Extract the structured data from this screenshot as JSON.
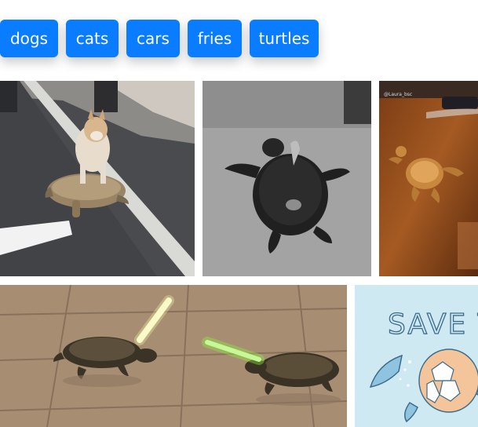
{
  "tags": [
    {
      "label": "dogs"
    },
    {
      "label": "cats"
    },
    {
      "label": "cars"
    },
    {
      "label": "fries"
    },
    {
      "label": "turtles"
    }
  ],
  "colors": {
    "tag_bg": "#0a7cff",
    "tag_text": "#ffffff",
    "page_bg": "#ffffff"
  },
  "gifs": [
    {
      "subject": "shiba dog riding tortoise on street",
      "icon": "dog-on-tortoise"
    },
    {
      "subject": "black turtle on grey floor",
      "icon": "turtle"
    },
    {
      "subject": "turtle on wooden table",
      "icon": "turtle",
      "caption": "@Laura_bsc"
    },
    {
      "subject": "two turtles with lightsabers",
      "icon": "turtles-lightsabers"
    },
    {
      "subject": "save the turtles illustration",
      "icon": "turtle-illustration",
      "text": "SAVE TH"
    }
  ]
}
